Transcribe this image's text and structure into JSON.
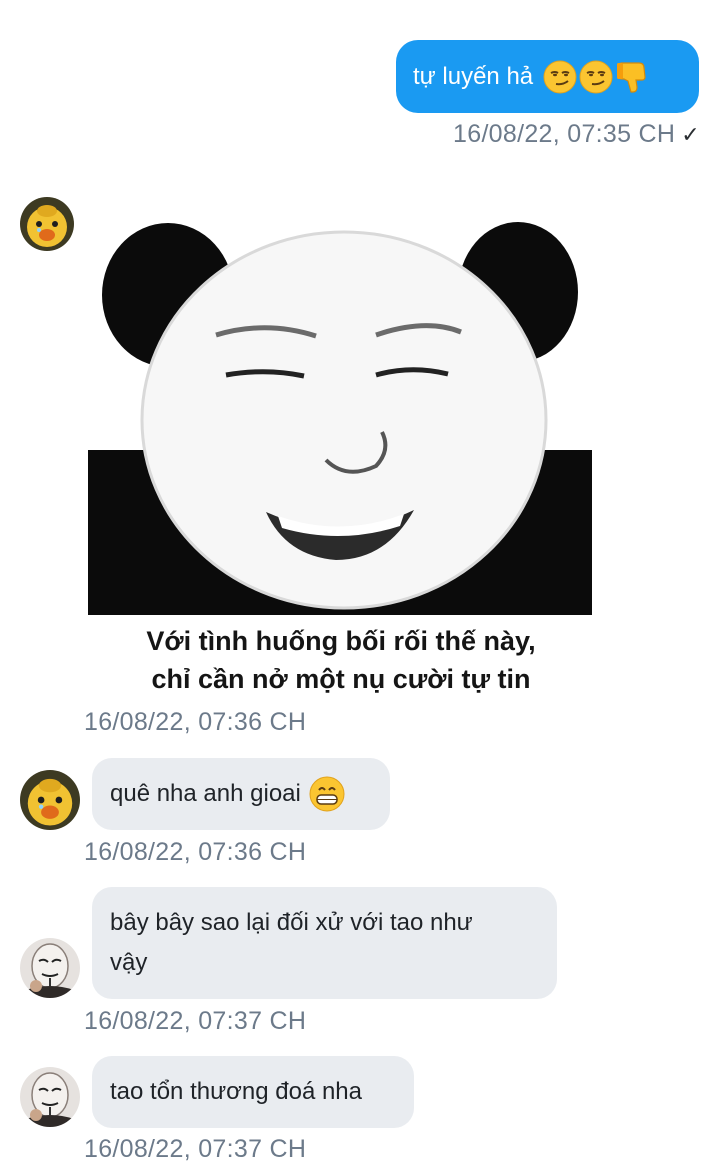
{
  "messages": {
    "outgoing_1": {
      "text": "tự luyến hả",
      "emojis": [
        "smirk-emoji",
        "smirk-emoji",
        "thumbs-down-emoji"
      ],
      "time": "16/08/22,  07:35 CH",
      "status": "✓"
    },
    "sticker_1": {
      "caption_line1": "Với tình huống bối rối thế này,",
      "caption_line2": "chỉ cần nở một nụ cười tự tin",
      "time": "16/08/22,  07:36 CH"
    },
    "incoming_1": {
      "text": "quê nha anh gioai",
      "emoji": "grin-emoji",
      "time": "16/08/22,  07:36 CH"
    },
    "incoming_2": {
      "line1": "bây bây sao lại đối xử với tao như",
      "line2": "vậy",
      "time": "16/08/22,  07:37 CH"
    },
    "incoming_3": {
      "text": "tao tổn thương đoá nha",
      "time": "16/08/22,  07:37 CH"
    }
  },
  "colors": {
    "outgoing_bubble": "#1a9af2",
    "incoming_bubble": "#e9ecf0",
    "timestamp": "#6c7a8a"
  }
}
